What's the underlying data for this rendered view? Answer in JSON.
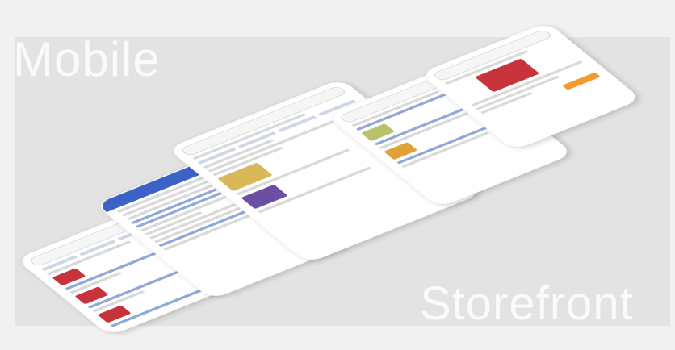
{
  "heading": {
    "word1": "Mobile",
    "word2": "Storefront"
  },
  "colors": {
    "accent_blue": "#3b62c6",
    "accent_orange": "#f29c2b",
    "panel": "#e3e3e3"
  },
  "phones": [
    {
      "id": "phone-product-list"
    },
    {
      "id": "phone-company-info"
    },
    {
      "id": "phone-store-home"
    },
    {
      "id": "phone-product-listing"
    },
    {
      "id": "phone-product-detail"
    }
  ]
}
